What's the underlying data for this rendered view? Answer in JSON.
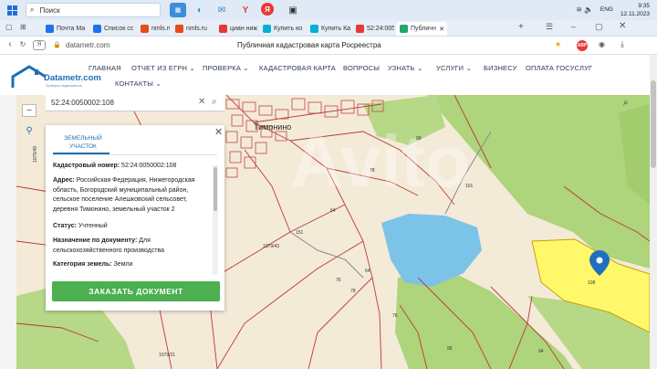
{
  "taskbar": {
    "search_label": "Поиск",
    "time": "9:35",
    "date": "12.11.2023",
    "lang": "ENG"
  },
  "tabs": [
    {
      "label": "Почта Ма",
      "color": "#1a73e8"
    },
    {
      "label": "Список сс",
      "color": "#1a73e8"
    },
    {
      "label": "nmls.ru",
      "color": "#e64a19"
    },
    {
      "label": "nmls.ru",
      "color": "#e64a19"
    },
    {
      "label": "циан ниж",
      "color": "#e53935"
    },
    {
      "label": "Купить ко",
      "color": "#00b2d6"
    },
    {
      "label": "Купить Ка",
      "color": "#00b2d6"
    },
    {
      "label": "52:24:0050",
      "color": "#e53935"
    },
    {
      "label": "Публичн",
      "color": "#22a86b"
    }
  ],
  "address": {
    "url": "datametr.com",
    "page_title": "Публичная кадастровая карта Росреестра"
  },
  "site": {
    "logo": "Datametr.com",
    "logo_sub": "Проверка недвижимости",
    "menu": [
      "ГЛАВНАЯ",
      "ОТЧЕТ ИЗ ЕГРН",
      "ПРОВЕРКА",
      "КАДАСТРОВАЯ КАРТА",
      "ВОПРОСЫ",
      "УЗНАТЬ",
      "УСЛУГИ",
      "БИЗНЕСУ",
      "ОПЛАТА ГОСУСЛУГ"
    ],
    "menu2": "КОНТАКТЫ"
  },
  "map": {
    "search_value": "52:24:0050002:108",
    "village": "Тимонино",
    "parcels": [
      "99",
      "101",
      "78",
      "64",
      "1079/43",
      "151",
      "64",
      "1079/49",
      "108",
      "76",
      "94",
      "1079/21",
      "96",
      "76",
      "78"
    ],
    "pin_color": "#1e6fbf",
    "selected_fill": "#fff86b"
  },
  "panel": {
    "tab_label": "ЗЕМЕЛЬНЫЙ УЧАСТОК",
    "cad_label": "Кадастровый номер:",
    "cad_value": "52:24:0050002:108",
    "addr_label": "Адрес:",
    "addr_value": "Российская Федерация, Нижегородская область, Богородский муниципальный район, сельское поселение Алешковский сельсовет, деревня Тимонино, земельный участок 2",
    "status_label": "Статус:",
    "status_value": "Учтенный",
    "purpose_label": "Назначение по документу:",
    "purpose_value": "Для сельскохозяйственного производства",
    "category_label": "Категория земель:",
    "category_value": "Земли",
    "order_button": "ЗАКАЗАТЬ ДОКУМЕНТ"
  }
}
